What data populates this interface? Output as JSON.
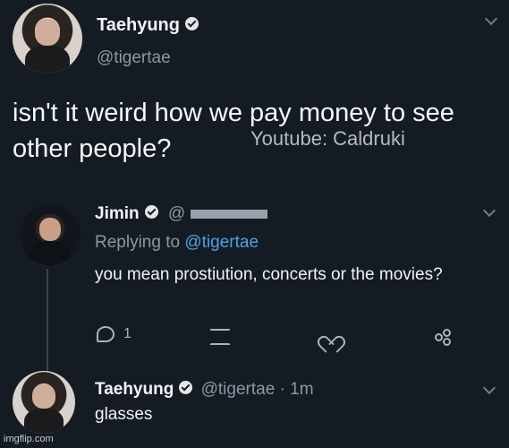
{
  "tweet": {
    "author_name": "Taehyung",
    "handle": "@tigertae",
    "text": "isn't it weird how we pay money to see other people?",
    "watermark": "Youtube: Caldruki"
  },
  "reply": {
    "author_name": "Jimin",
    "handle_prefix": "@",
    "replying_label": "Replying to",
    "replying_handle": "@tigertae",
    "text": "you mean prostiution, concerts or the movies?",
    "reply_count": "1"
  },
  "reply2": {
    "author_name": "Taehyung",
    "handle": "@tigertae",
    "time": "· 1m",
    "text": "glasses"
  },
  "footer": {
    "watermark": "imgflip.com"
  },
  "icons": [
    "avatar",
    "verified-icon",
    "chevron-down-icon",
    "reply-icon",
    "retweet-icon",
    "like-icon",
    "share-icon"
  ]
}
